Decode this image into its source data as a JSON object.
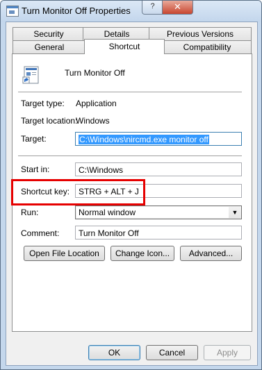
{
  "window": {
    "title": "Turn Monitor Off Properties",
    "help_glyph": "?",
    "close_glyph": "✕"
  },
  "tabs": {
    "row1": [
      "Security",
      "Details",
      "Previous Versions"
    ],
    "row2": [
      "General",
      "Shortcut",
      "Compatibility"
    ],
    "selected": "Shortcut"
  },
  "shortcut": {
    "name": "Turn Monitor Off",
    "target_type_label": "Target type:",
    "target_type_value": "Application",
    "target_location_label": "Target location:",
    "target_location_value": "Windows",
    "target_label": "Target:",
    "target_value": "C:\\Windows\\nircmd.exe monitor off",
    "start_in_label": "Start in:",
    "start_in_value": "C:\\Windows",
    "shortcut_key_label": "Shortcut key:",
    "shortcut_key_value": "STRG + ALT + J",
    "run_label": "Run:",
    "run_value": "Normal window",
    "comment_label": "Comment:",
    "comment_value": "Turn Monitor Off"
  },
  "actions": {
    "open_file_location": "Open File Location",
    "change_icon": "Change Icon...",
    "advanced": "Advanced..."
  },
  "footer": {
    "ok": "OK",
    "cancel": "Cancel",
    "apply": "Apply"
  },
  "colors": {
    "annotation": "#e60000",
    "selection": "#3399ff"
  }
}
